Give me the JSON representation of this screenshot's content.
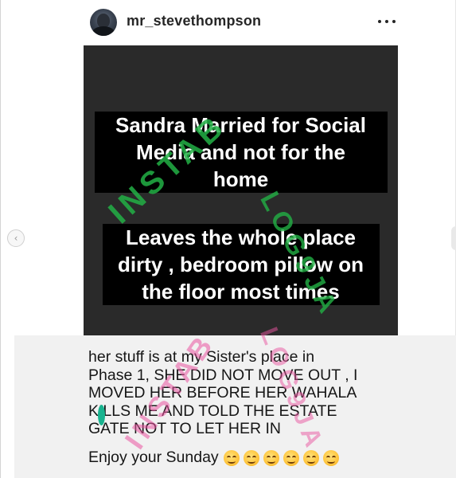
{
  "header": {
    "username": "mr_stevethompson",
    "more_icon": "more-horizontal-icon"
  },
  "nav": {
    "prev_arrow": "‹",
    "prev_icon": "chevron-left-icon"
  },
  "image": {
    "background_color": "#2a2a2a",
    "caption_1": [
      "Sandra Married for Social",
      "Media and not for the",
      "home"
    ],
    "caption_2": [
      "Leaves the whole place",
      "dirty , bedroom pillow on",
      "the floor most times"
    ],
    "watermark": "INSTABLOG9JA",
    "watermark_colors": [
      "#22b045",
      "#e954a0"
    ]
  },
  "caption": {
    "lines": [
      "her stuff is at my Sister's place in",
      "Phase 1,  SHE DID NOT MOVE OUT , I",
      "MOVED HER BEFORE HER WAHALA",
      "KILLS ME AND TOLD THE ESTATE",
      "GATE NOT TO LET HER IN"
    ],
    "closing": "Enjoy your Sunday",
    "emoji_count": 6,
    "emoji_icon": "smiling-face-icon"
  }
}
